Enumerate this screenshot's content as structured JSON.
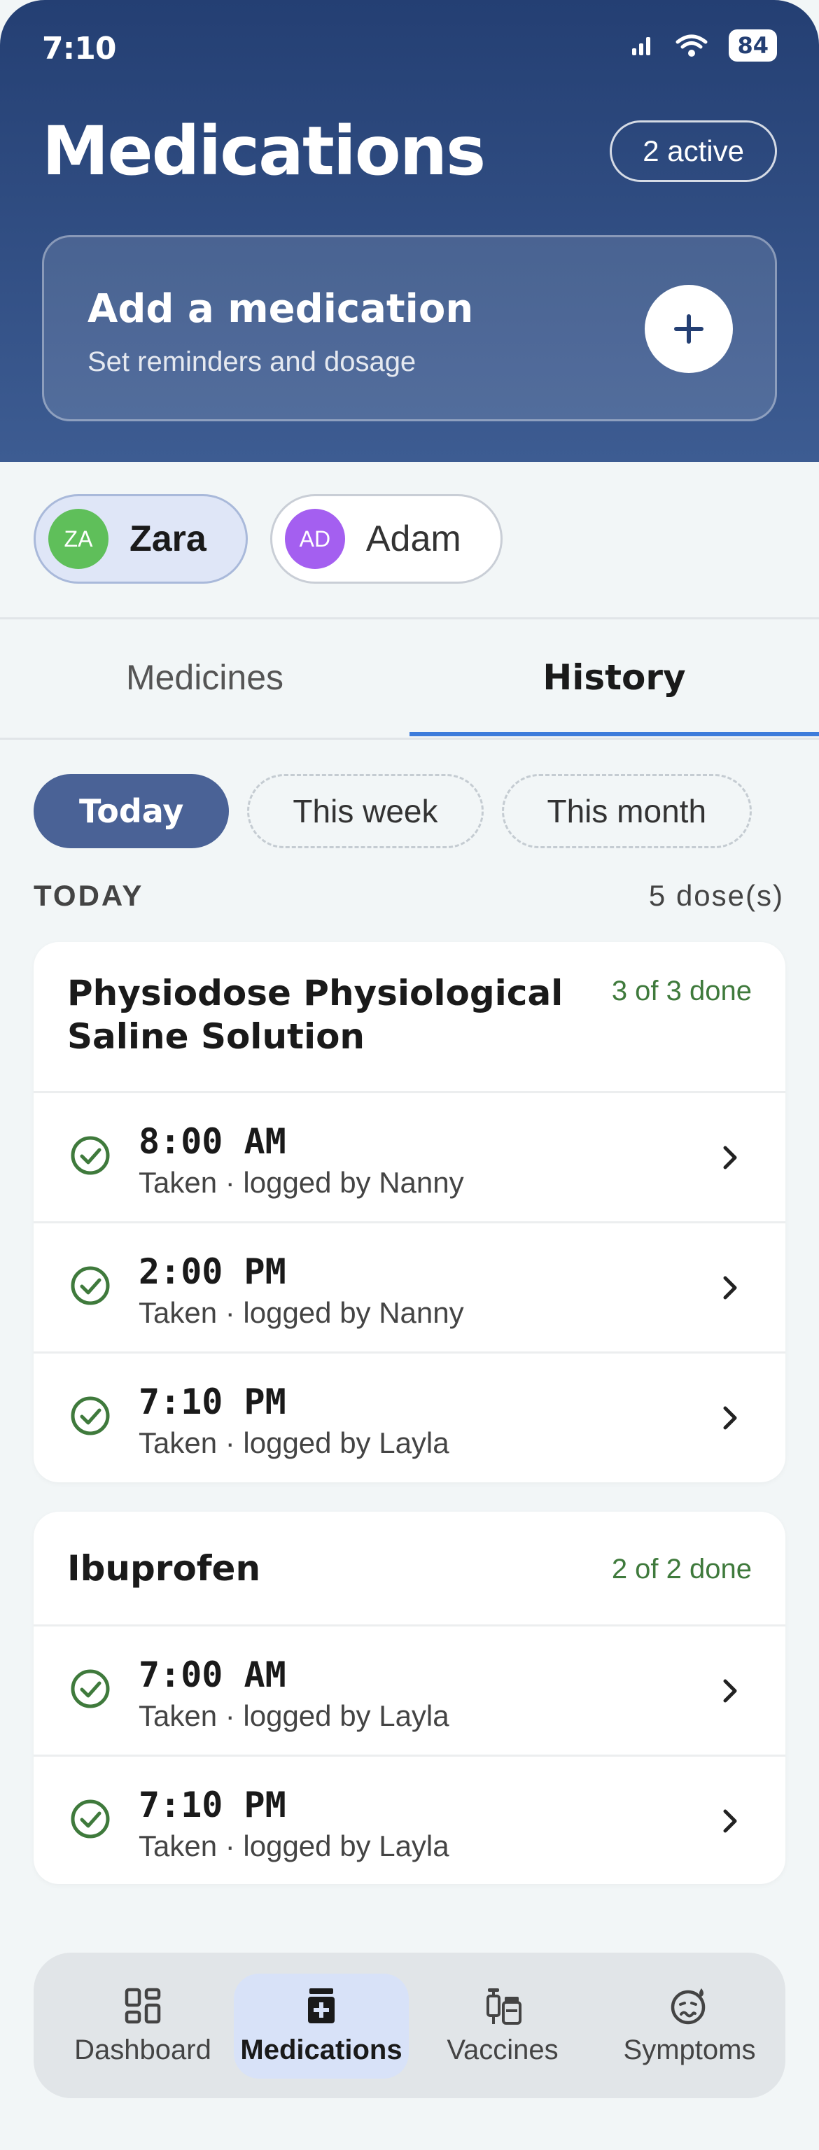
{
  "status": {
    "time": "7:10",
    "battery": "84"
  },
  "header": {
    "title": "Medications",
    "active_badge": "2 active",
    "add_card": {
      "title": "Add a medication",
      "subtitle": "Set reminders and dosage"
    }
  },
  "people": [
    {
      "initials": "ZA",
      "name": "Zara",
      "color": "#5fbf5a",
      "selected": true
    },
    {
      "initials": "AD",
      "name": "Adam",
      "color": "#a45ff0",
      "selected": false
    }
  ],
  "tabs": {
    "medicines": "Medicines",
    "history": "History",
    "active": "History"
  },
  "filters": {
    "today": "Today",
    "week": "This week",
    "month": "This month",
    "selected": "Today"
  },
  "section": {
    "label": "TODAY",
    "count": "5 dose(s)"
  },
  "medications": [
    {
      "name_line1": "Physiodose Physiological",
      "name_line2": "Saline Solution",
      "done": "3 of 3 done",
      "doses": [
        {
          "time": "8:00 AM",
          "status": "Taken · logged by Nanny"
        },
        {
          "time": "2:00 PM",
          "status": "Taken · logged by Nanny"
        },
        {
          "time": "7:10 PM",
          "status": "Taken · logged by Layla"
        }
      ]
    },
    {
      "name_line1": "Ibuprofen",
      "done": "2 of 2 done",
      "doses": [
        {
          "time": "7:00 AM",
          "status": "Taken · logged by Layla"
        },
        {
          "time": "7:10 PM",
          "status": "Taken · logged by Layla"
        }
      ]
    }
  ],
  "nav": {
    "dashboard": "Dashboard",
    "medications": "Medications",
    "vaccines": "Vaccines",
    "symptoms": "Symptoms",
    "active": "Medications"
  },
  "colors": {
    "header_top": "#243f73",
    "accent": "#3d7cdb",
    "done_green": "#3f7a3c",
    "chip_selected": "#4a6296"
  }
}
